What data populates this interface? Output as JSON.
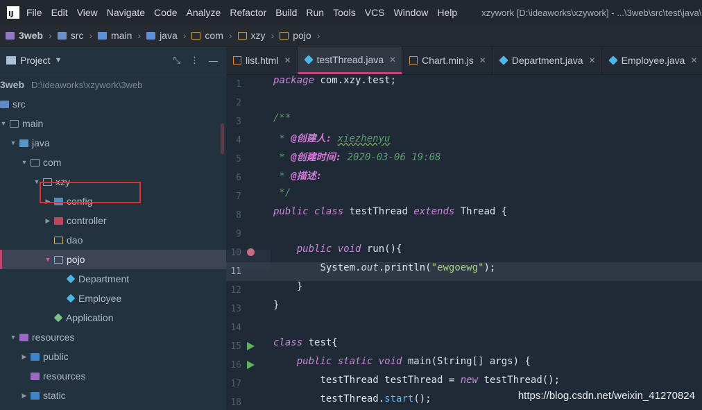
{
  "menu": {
    "items": [
      "File",
      "Edit",
      "View",
      "Navigate",
      "Code",
      "Analyze",
      "Refactor",
      "Build",
      "Run",
      "Tools",
      "VCS",
      "Window",
      "Help"
    ],
    "window_title": "xzywork [D:\\ideaworks\\xzywork] - ...\\3web\\src\\test\\java\\"
  },
  "breadcrumb": [
    "3web",
    "src",
    "main",
    "java",
    "com",
    "xzy",
    "pojo"
  ],
  "project_panel": {
    "title": "Project",
    "tree": [
      {
        "label": "3web",
        "path": "D:\\ideaworks\\xzywork\\3web"
      },
      {
        "label": "src"
      },
      {
        "label": "main"
      },
      {
        "label": "java"
      },
      {
        "label": "com"
      },
      {
        "label": "xzy"
      },
      {
        "label": "config"
      },
      {
        "label": "controller"
      },
      {
        "label": "dao"
      },
      {
        "label": "pojo"
      },
      {
        "label": "Department"
      },
      {
        "label": "Employee"
      },
      {
        "label": "Application"
      },
      {
        "label": "resources"
      },
      {
        "label": "public"
      },
      {
        "label": "resources"
      },
      {
        "label": "static"
      }
    ]
  },
  "tabs": [
    {
      "label": "list.html"
    },
    {
      "label": "testThread.java"
    },
    {
      "label": "Chart.min.js"
    },
    {
      "label": "Department.java"
    },
    {
      "label": "Employee.java"
    }
  ],
  "editor": {
    "line_numbers": [
      "1",
      "2",
      "3",
      "4",
      "5",
      "6",
      "7",
      "8",
      "9",
      "10",
      "11",
      "12",
      "13",
      "14",
      "15",
      "16",
      "17",
      "18"
    ],
    "code": {
      "l1_kw": "package",
      "l1_pkg": " com.xzy.test;",
      "l3": "/**",
      "l4_star": " * ",
      "l4_tag": "@创建人:",
      "l4_val": "xiezhenyu",
      "l5_star": " * ",
      "l5_tag": "@创建时间:",
      "l5_val": "2020-03-06 19:08",
      "l6_star": " * ",
      "l6_tag": "@描述:",
      "l7": " */",
      "l8_kw1": "public class",
      "l8_name": " testThread ",
      "l8_kw2": "extends",
      "l8_cls": " Thread {",
      "l10_indent": "    ",
      "l10_kw": "public void",
      "l10_rest": " run(){",
      "l11_indent": "        ",
      "l11_sys": "System.",
      "l11_out": "out",
      "l11_println": ".println(",
      "l11_str": "\"ewgoewg\"",
      "l11_end": ");",
      "l12": "    }",
      "l13": "}",
      "l15_kw": "class",
      "l15_rest": " test{",
      "l16_indent": "    ",
      "l16_kw": "public static void",
      "l16_main": " main(",
      "l16_type": "String",
      "l16_rest": "[] args) {",
      "l17_indent": "        ",
      "l17_t1": "testThread testThread = ",
      "l17_new": "new",
      "l17_t2": " testThread",
      "l17_end": "();",
      "l18_indent": "        ",
      "l18_t": "testThread.",
      "l18_fn": "start",
      "l18_end": "();"
    }
  },
  "watermark": "https://blog.csdn.net/weixin_41270824"
}
